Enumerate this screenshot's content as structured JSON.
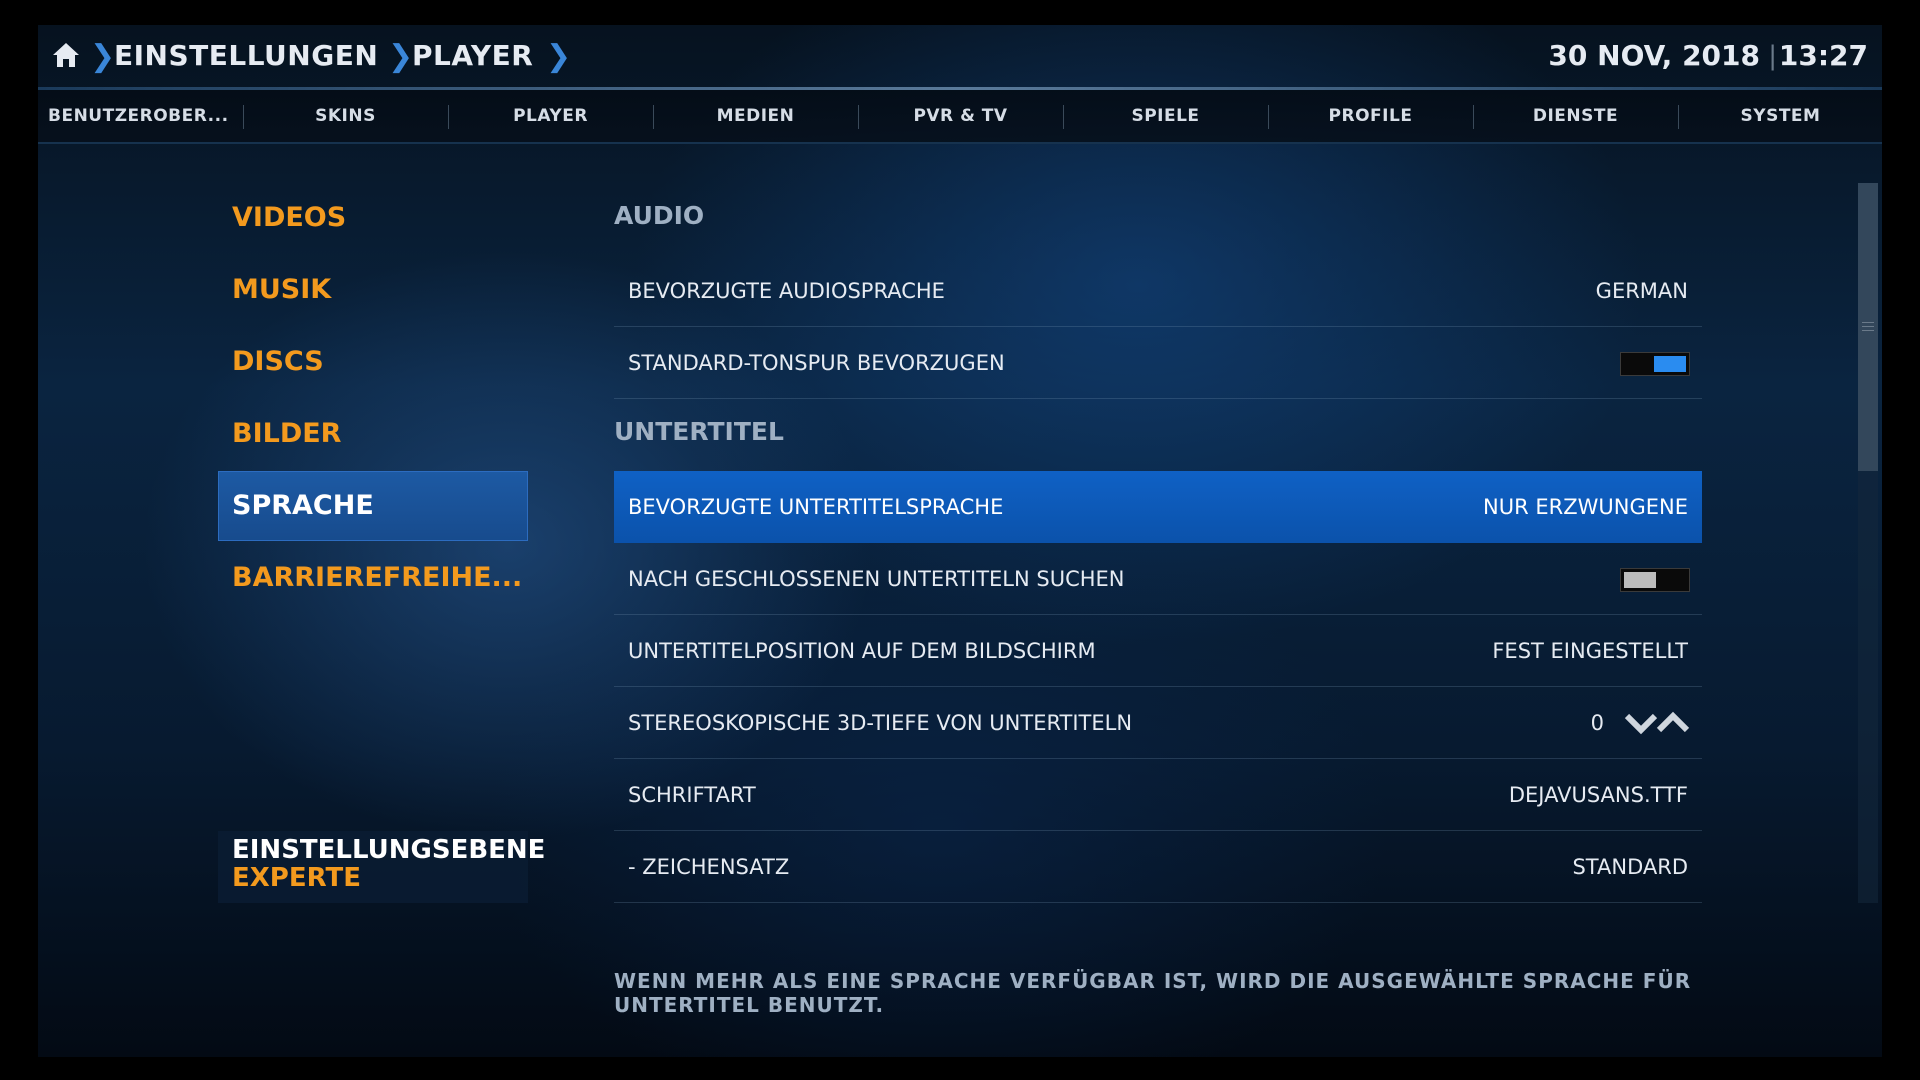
{
  "header": {
    "breadcrumbs": [
      "EINSTELLUNGEN",
      "PLAYER"
    ],
    "date": "30 NOV, 2018",
    "time_separator": "|",
    "time": "13:27",
    "home_icon": "home-icon",
    "separator_icon": "chevron-right-icon"
  },
  "tabs": [
    {
      "label": "BENUTZEROBER..."
    },
    {
      "label": "SKINS"
    },
    {
      "label": "PLAYER"
    },
    {
      "label": "MEDIEN"
    },
    {
      "label": "PVR & TV"
    },
    {
      "label": "SPIELE"
    },
    {
      "label": "PROFILE"
    },
    {
      "label": "DIENSTE"
    },
    {
      "label": "SYSTEM"
    }
  ],
  "menu": {
    "items": [
      {
        "label": "VIDEOS"
      },
      {
        "label": "MUSIK"
      },
      {
        "label": "DISCS"
      },
      {
        "label": "BILDER"
      },
      {
        "label": "SPRACHE",
        "active": true
      },
      {
        "label": "BARRIEREFREIHE..."
      }
    ],
    "level_title": "EINSTELLUNGSEBENE",
    "level_value": "EXPERTE"
  },
  "settings": {
    "audio_header": "AUDIO",
    "subtitle_header": "UNTERTITEL",
    "audio_language": {
      "label": "BEVORZUGTE AUDIOSPRACHE",
      "value": "GERMAN"
    },
    "default_track": {
      "label": "STANDARD-TONSPUR BEVORZUGEN",
      "state": "on"
    },
    "subtitle_language": {
      "label": "BEVORZUGTE UNTERTITELSPRACHE",
      "value": "NUR ERZWUNGENE"
    },
    "closed_captions": {
      "label": "NACH GESCHLOSSENEN UNTERTITELN SUCHEN",
      "state": "off"
    },
    "subtitle_position": {
      "label": "UNTERTITELPOSITION AUF DEM BILDSCHIRM",
      "value": "FEST EINGESTELLT"
    },
    "stereo_depth": {
      "label": "STEREOSKOPISCHE 3D-TIEFE VON UNTERTITELN",
      "value": "0"
    },
    "font": {
      "label": "SCHRIFTART",
      "value": "DEJAVUSANS.TTF"
    },
    "charset": {
      "label": "- ZEICHENSATZ",
      "value": "STANDARD"
    }
  },
  "description": "WENN MEHR ALS EINE SPRACHE VERFÜGBAR IST, WIRD DIE AUSGEWÄHLTE SPRACHE FÜR UNTERTITEL BENUTZT.",
  "colors": {
    "accent_orange": "#f39a1e",
    "focus_blue": "#0f61c5",
    "toggle_on": "#2a8cf0",
    "breadcrumb_separator": "#3a86d8"
  }
}
